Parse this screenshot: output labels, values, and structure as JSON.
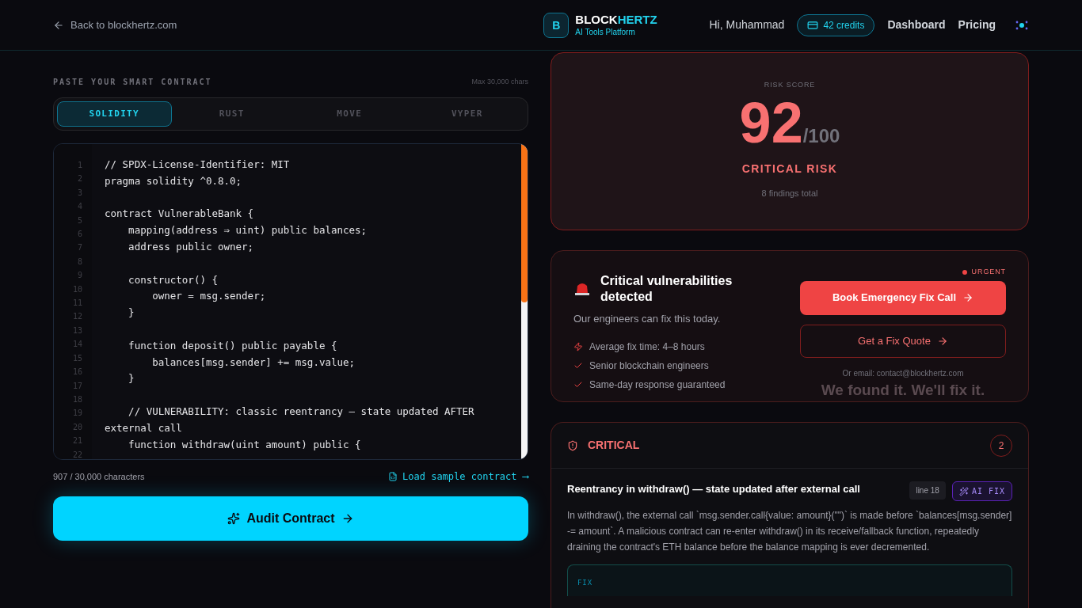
{
  "header": {
    "back_link": "Back to blockhertz.com",
    "logo_letter": "B",
    "brand_primary": "BLOCK",
    "brand_accent": "HERTZ",
    "brand_tagline": "AI Tools Platform",
    "greeting": "Hi, Muhammad",
    "credits": "42 credits",
    "nav": [
      "Dashboard",
      "Pricing"
    ]
  },
  "editor": {
    "label": "PASTE YOUR SMART CONTRACT",
    "max": "Max 30,000 chars",
    "tabs": [
      {
        "label": "SOLIDITY",
        "selected": true
      },
      {
        "label": "RUST",
        "selected": false
      },
      {
        "label": "MOVE",
        "selected": false
      },
      {
        "label": "VYPER",
        "selected": false
      }
    ],
    "line_numbers": [
      "1",
      "2",
      "3",
      "4",
      "5",
      "6",
      "7",
      "8",
      "9",
      "10",
      "11",
      "12",
      "13",
      "14",
      "15",
      "16",
      "17",
      "18",
      "19",
      "20",
      "21",
      "22"
    ],
    "code": [
      {
        "kind": "code",
        "text": "// SPDX-License-Identifier: MIT"
      },
      {
        "kind": "code",
        "text": "pragma solidity ^0.8.0;"
      },
      {
        "kind": "blank"
      },
      {
        "kind": "code",
        "text": "contract VulnerableBank {"
      },
      {
        "kind": "code",
        "text": "    mapping(address ⇒ uint) public balances;"
      },
      {
        "kind": "code",
        "text": "    address public owner;"
      },
      {
        "kind": "blank"
      },
      {
        "kind": "code",
        "text": "    constructor() {"
      },
      {
        "kind": "code",
        "text": "        owner = msg.sender;"
      },
      {
        "kind": "code",
        "text": "    }"
      },
      {
        "kind": "blank"
      },
      {
        "kind": "code",
        "text": "    function deposit() public payable {"
      },
      {
        "kind": "code",
        "text": "        balances[msg.sender] += msg.value;"
      },
      {
        "kind": "code",
        "text": "    }"
      },
      {
        "kind": "blank"
      },
      {
        "kind": "code",
        "text": "    // VULNERABILITY: classic reentrancy — state updated AFTER"
      },
      {
        "kind": "code",
        "text": "external call"
      },
      {
        "kind": "code",
        "text": "    function withdraw(uint amount) public {"
      }
    ],
    "count": "907 / 30,000 characters",
    "sample_link": "Load sample contract ⟶",
    "audit_button": "Audit Contract"
  },
  "risk": {
    "label": "RISK SCORE",
    "score": "92",
    "out_of": "/100",
    "level": "CRITICAL RISK",
    "findings": "8 findings total"
  },
  "cta": {
    "title": "Critical vulnerabilities detected",
    "subtitle": "Our engineers can fix this today.",
    "points": [
      {
        "kind": "bolt",
        "text": "Average fix time: 4–8 hours"
      },
      {
        "kind": "check",
        "text": "Senior blockchain engineers"
      },
      {
        "kind": "check",
        "text": "Same-day response guaranteed"
      }
    ],
    "badge": "URGENT",
    "primary_button": "Book Emergency Fix Call",
    "secondary_button": "Get a Fix Quote",
    "email": "Or email: contact@blockhertz.com",
    "tagline": "We found it. We'll fix it."
  },
  "findings_group": {
    "severity": "CRITICAL",
    "count": "2",
    "finding": {
      "title": "Reentrancy in withdraw() — state updated after external call",
      "line": "line 18",
      "ai_fix": "AI FIX",
      "description": "In withdraw(), the external call `msg.sender.call{value: amount}(\"\")` is made before `balances[msg.sender] -= amount`. A malicious contract can re-enter withdraw() in its receive/fallback function, repeatedly draining the contract's ETH balance before the balance mapping is ever decremented.",
      "fix_label": "FIX"
    }
  }
}
